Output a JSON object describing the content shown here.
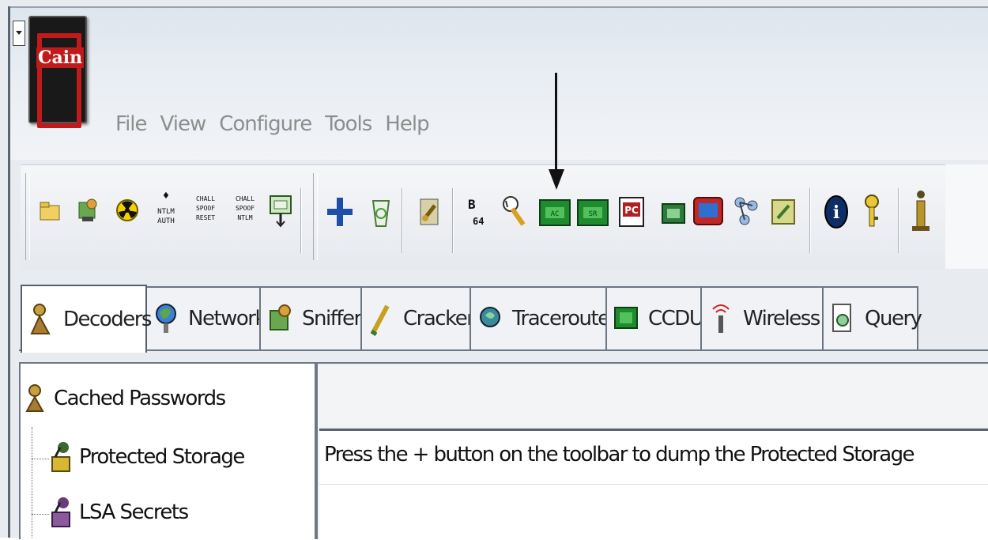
{
  "app": {
    "logo_text": "Cain",
    "logo_icon": "cain-logo-icon"
  },
  "menubar": {
    "items": [
      "File",
      "View",
      "Configure",
      "Tools",
      "Help"
    ]
  },
  "toolbar": {
    "icons": [
      "open-folder-icon",
      "sniffer-start-icon",
      "radiation-icon",
      "ntlm-auth-icon",
      "challenge-spoof-reset-icon",
      "challenge-spoof-ntlm-icon",
      "monitor-icon",
      "add-plus-icon",
      "recycle-icon",
      "brush-icon",
      "base64-icon",
      "lsa-icon",
      "green-chip-1-icon",
      "green-chip-2-icon",
      "pc-icon",
      "chip-icon",
      "screen-icon",
      "network-icon",
      "page-icon",
      "info-icon",
      "key-icon",
      "help-icon"
    ],
    "ntlm_label": "NTLM AUTH",
    "reset_label": "CHALL SPOOF RESET",
    "ntlm2_label": "CHALL SPOOF NTLM",
    "base64_label": "B 64"
  },
  "tabs": [
    {
      "label": "Decoders",
      "icon": "decoders-icon",
      "active": true
    },
    {
      "label": "Network",
      "icon": "network-globe-icon"
    },
    {
      "label": "Sniffer",
      "icon": "sniffer-icon"
    },
    {
      "label": "Cracker",
      "icon": "cracker-icon"
    },
    {
      "label": "Traceroute",
      "icon": "traceroute-icon"
    },
    {
      "label": "CCDU",
      "icon": "ccdu-icon"
    },
    {
      "label": "Wireless",
      "icon": "wireless-icon"
    },
    {
      "label": "Query",
      "icon": "query-icon"
    }
  ],
  "tree": {
    "root": "Cached Passwords",
    "children": [
      "Protected Storage",
      "LSA Secrets"
    ]
  },
  "pane": {
    "message": "Press the + button on the toolbar to dump the Protected Storage"
  },
  "colors": {
    "logo_red": "#c01a1a",
    "chip_green": "#1f8a2e",
    "plus_blue": "#1e4ea8",
    "menu_gray": "#8e8e8e"
  }
}
